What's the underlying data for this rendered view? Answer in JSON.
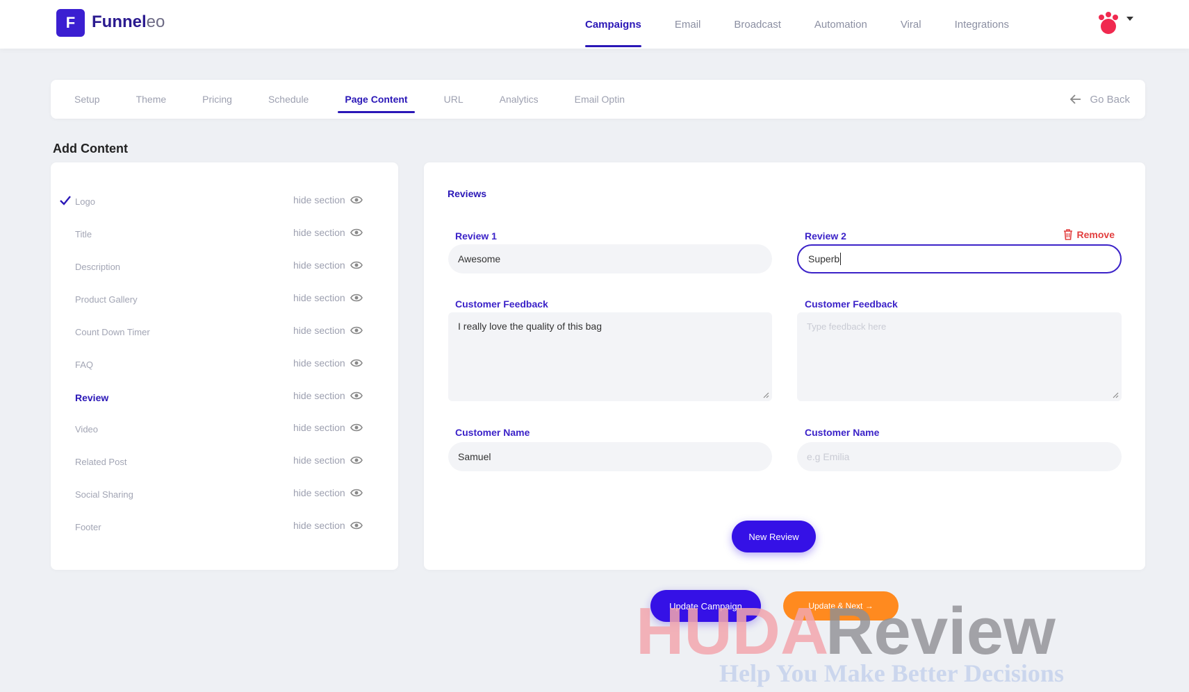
{
  "brand": {
    "logo_letter": "F",
    "name_bold": "Funnel",
    "name_thin": "eo"
  },
  "main_nav": [
    {
      "label": "Campaigns",
      "active": true
    },
    {
      "label": "Email"
    },
    {
      "label": "Broadcast"
    },
    {
      "label": "Automation"
    },
    {
      "label": "Viral"
    },
    {
      "label": "Integrations"
    }
  ],
  "tabs": [
    {
      "label": "Setup"
    },
    {
      "label": "Theme"
    },
    {
      "label": "Pricing"
    },
    {
      "label": "Schedule"
    },
    {
      "label": "Page Content",
      "active": true
    },
    {
      "label": "URL"
    },
    {
      "label": "Analytics"
    },
    {
      "label": "Email Optin"
    }
  ],
  "go_back": "Go Back",
  "add_content_title": "Add Content",
  "sections": [
    {
      "label": "Logo",
      "checked": true
    },
    {
      "label": "Title"
    },
    {
      "label": "Description"
    },
    {
      "label": "Product Gallery"
    },
    {
      "label": "Count Down Timer"
    },
    {
      "label": "FAQ"
    },
    {
      "label": "Review",
      "active": true
    },
    {
      "label": "Video"
    },
    {
      "label": "Related Post"
    },
    {
      "label": "Social Sharing"
    },
    {
      "label": "Footer"
    }
  ],
  "hide_section_label": "hide section",
  "reviews": {
    "title": "Reviews",
    "remove_label": "Remove",
    "review1": {
      "label": "Review 1",
      "value": "Awesome",
      "feedback_label": "Customer Feedback",
      "feedback_value": "I really love the quality of this bag",
      "name_label": "Customer Name",
      "name_value": "Samuel"
    },
    "review2": {
      "label": "Review 2",
      "value": "Superb",
      "feedback_label": "Customer Feedback",
      "feedback_placeholder": "Type feedback here",
      "name_label": "Customer Name",
      "name_placeholder": "e.g Emilia"
    },
    "new_review_button": "New Review"
  },
  "footer_buttons": {
    "update": "Update Campaign",
    "next": "Update & Next →"
  },
  "watermark": {
    "line1_a": "HUDA",
    "line1_b": "Review",
    "line2": "Help You Make Better Decisions"
  },
  "colors": {
    "accent": "#2a17b7",
    "primary_button": "#3511e6",
    "orange_button": "#ff8a1f",
    "danger": "#e23e3e"
  }
}
